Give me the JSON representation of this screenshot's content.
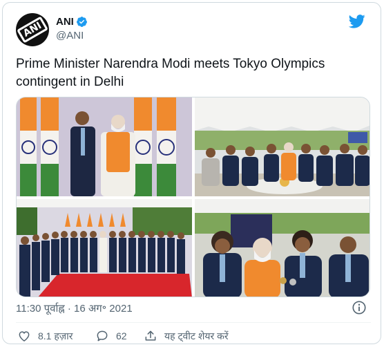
{
  "tweet": {
    "display_name": "ANI",
    "handle": "@ANI",
    "logo_text": "ANI",
    "text": "Prime Minister Narendra Modi meets Tokyo Olympics contingent in Delhi",
    "timestamp": "11:30 पूर्वाह्न · 16 अग॰ 2021"
  },
  "actions": {
    "likes": "8.1 हज़ार",
    "replies": "62",
    "share": "यह ट्वीट शेयर करें"
  },
  "colors": {
    "brand_blue": "#1d9bf0",
    "text_secondary": "#536471",
    "border": "#cfd9de"
  },
  "icons": [
    "verified-badge-icon",
    "twitter-bird-icon",
    "info-icon",
    "heart-icon",
    "reply-icon",
    "share-icon"
  ]
}
